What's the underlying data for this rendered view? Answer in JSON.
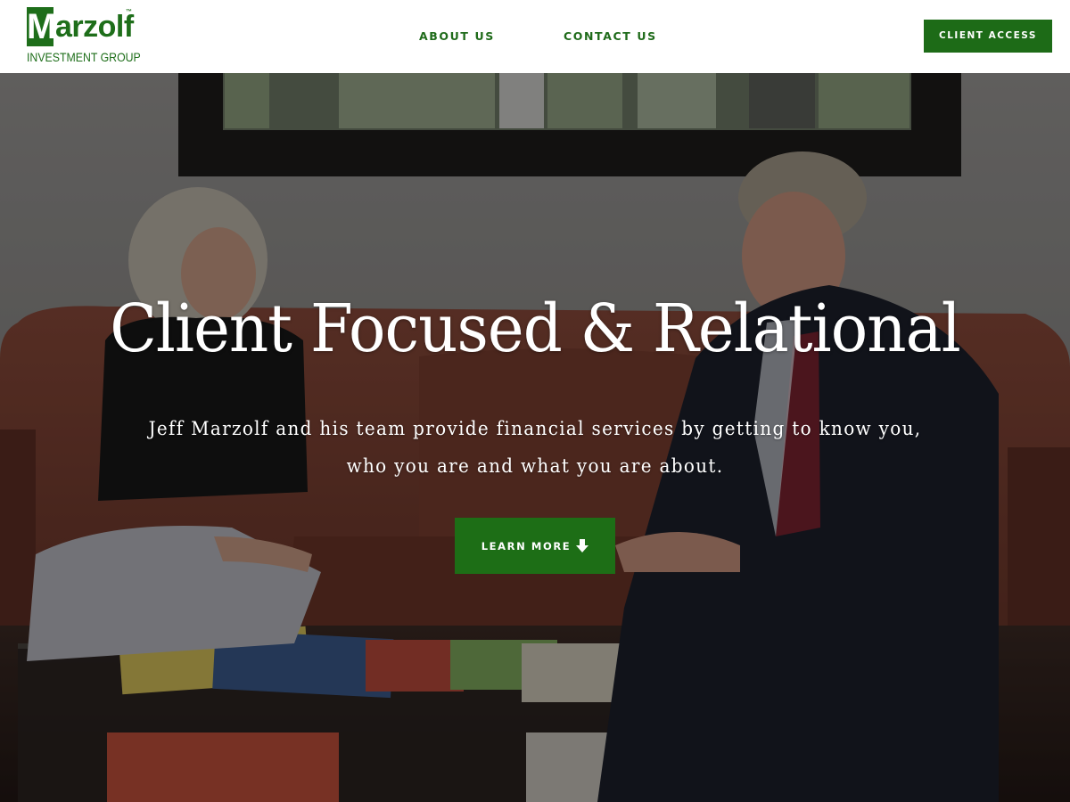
{
  "brand": {
    "logo_initial": "M",
    "logo_rest": "arzolf",
    "logo_tm": "™",
    "logo_subtitle": "INVESTMENT GROUP",
    "color": "#1e6e1a"
  },
  "nav": {
    "items": [
      {
        "label": "ABOUT US"
      },
      {
        "label": "CONTACT US"
      }
    ],
    "cta_label": "CLIENT ACCESS"
  },
  "hero": {
    "title": "Client Focused & Relational",
    "subtitle_line1": "Jeff Marzolf and his team provide financial services by getting to know you,",
    "subtitle_line2": "who you are and what you are about.",
    "button_label": "LEARN MORE",
    "button_icon": "arrow-down-icon",
    "button_color": "#1d6e16",
    "background_image": "photo of two people talking on a leather sofa"
  }
}
